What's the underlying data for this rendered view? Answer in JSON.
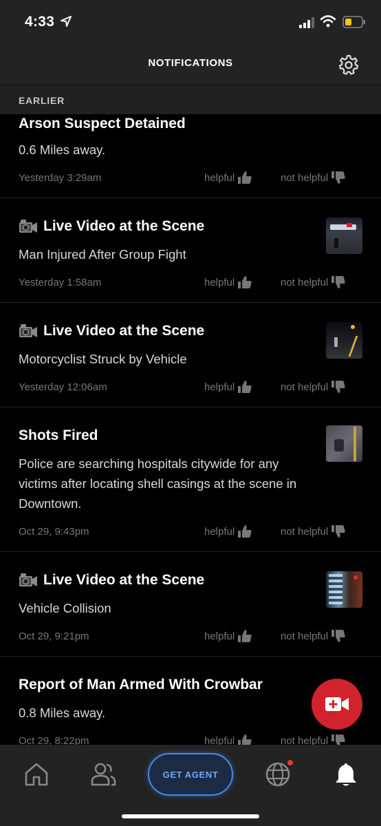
{
  "status_bar": {
    "time": "4:33"
  },
  "header": {
    "title": "NOTIFICATIONS"
  },
  "section": {
    "label": "EARLIER"
  },
  "feedback": {
    "helpful": "helpful",
    "not_helpful": "not helpful"
  },
  "notifications": [
    {
      "title": "Arson Suspect Detained",
      "body": "0.6 Miles away.",
      "time": "Yesterday 3:29am",
      "live_video": false
    },
    {
      "title": "Live Video at the Scene",
      "body": "Man Injured After Group Fight",
      "time": "Yesterday 1:58am",
      "live_video": true
    },
    {
      "title": "Live Video at the Scene",
      "body": "Motorcyclist Struck by Vehicle",
      "time": "Yesterday 12:06am",
      "live_video": true
    },
    {
      "title": "Shots Fired",
      "body": "Police are searching hospitals citywide for any victims after locating shell casings at the scene in Downtown.",
      "time": "Oct 29, 9:43pm",
      "live_video": false
    },
    {
      "title": "Live Video at the Scene",
      "body": "Vehicle Collision",
      "time": "Oct 29, 9:21pm",
      "live_video": true
    },
    {
      "title": "Report of Man Armed With Crowbar",
      "body": "0.8 Miles away.",
      "time": "Oct 29, 8:22pm",
      "live_video": false
    }
  ],
  "bottom_nav": {
    "get_agent": "GET AGENT"
  },
  "colors": {
    "accent_blue": "#3e8cf1",
    "fab_red": "#d0232e",
    "background": "#000000",
    "bar": "#232323"
  }
}
